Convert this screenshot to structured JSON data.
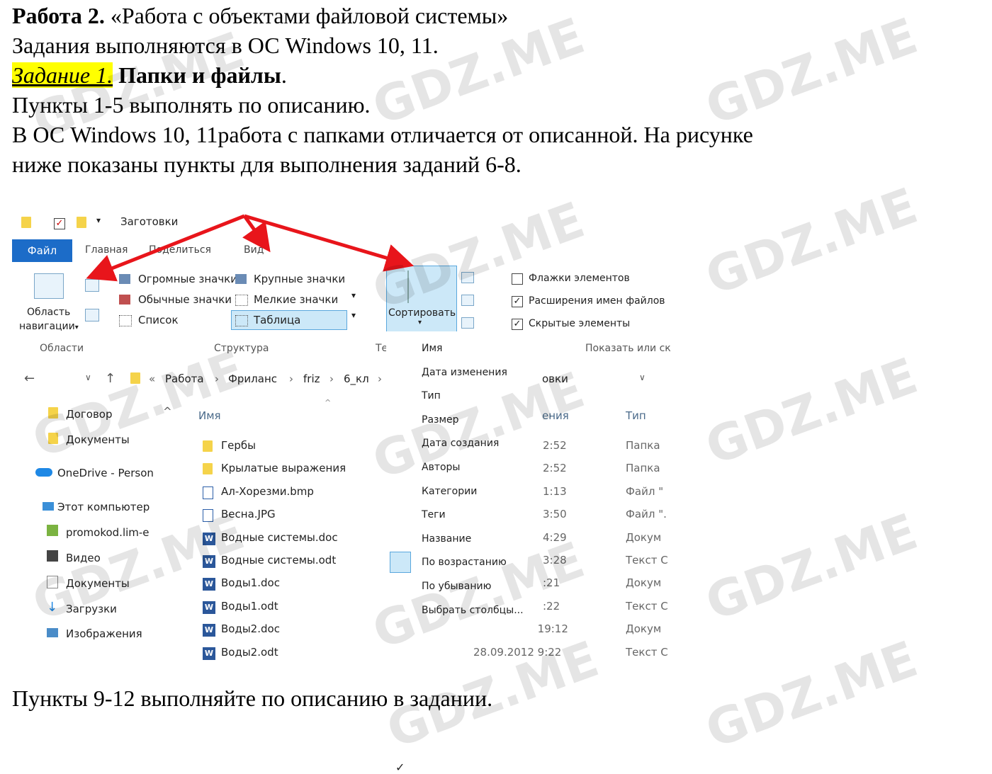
{
  "doc": {
    "title_bold": "Работа 2.",
    "title_rest": " «Работа с объектами файловой системы»",
    "os_line": "Задания выполняются в ОС Windows 10, 11.",
    "task_label": "Задание 1.",
    "task_title": " Папки и файлы",
    "task_dot": ".",
    "items_1_5": "Пункты 1-5 выполнять по описанию.",
    "note_line1": "В ОС Windows 10, 11работа с папками отличается от описанной. На рисунке",
    "note_line2": "ниже показаны пункты для выполнения заданий 6-8.",
    "items_9_12": "Пункты 9-12 выполняйте по описанию в задании."
  },
  "explorer": {
    "window_title": "Заготовки",
    "tabs": {
      "file": "Файл",
      "home": "Главная",
      "share": "Поделиться",
      "view": "Вид"
    },
    "ribbon": {
      "nav_pane": "Область",
      "nav_pane2": "навигации",
      "nav_pane_arrow": "▾",
      "layout": [
        "Огромные значки",
        "Крупные значки",
        "Обычные значки",
        "Мелкие значки",
        "Список",
        "Таблица"
      ],
      "sort": "Сортировать",
      "checkboxes": [
        "Флажки элементов",
        "Расширения имен файлов",
        "Скрытые элементы"
      ],
      "checked": [
        false,
        true,
        true
      ],
      "groups": {
        "panes": "Области",
        "structure": "Структура",
        "current": "Те",
        "show": "Показать или ск"
      }
    },
    "address": [
      "Работа",
      "Фриланс",
      "friz",
      "6_кл"
    ],
    "address_tail": "овки",
    "sort_menu": [
      "Имя",
      "Дата изменения",
      "Тип",
      "Размер",
      "Дата создания",
      "Авторы",
      "Категории",
      "Теги",
      "Название",
      "По возрастанию",
      "По убыванию",
      "Выбрать столбцы..."
    ],
    "nav_items": [
      "Договор",
      "Документы",
      "OneDrive - Person",
      "Этот компьютер",
      "promokod.lim-e",
      "Видео",
      "Документы",
      "Загрузки",
      "Изображения"
    ],
    "columns": {
      "name": "Имя",
      "date": "ения",
      "type": "Тип"
    },
    "files": [
      {
        "name": "Гербы",
        "date": "2:52",
        "type": "Папка"
      },
      {
        "name": "Крылатые выражения",
        "date": "2:52",
        "type": "Папка"
      },
      {
        "name": "Ал-Хорезми.bmp",
        "date": "1:13",
        "type": "Файл \""
      },
      {
        "name": "Весна.JPG",
        "date": "3:50",
        "type": "Файл \"."
      },
      {
        "name": "Водные системы.doc",
        "date": "4:29",
        "type": "Докум"
      },
      {
        "name": "Водные системы.odt",
        "date": "3:28",
        "type": "Текст С"
      },
      {
        "name": "Воды1.doc",
        "date": ":21",
        "type": "Докум"
      },
      {
        "name": "Воды1.odt",
        "date": ":22",
        "type": "Текст С"
      },
      {
        "name": "Воды2.doc",
        "date": "27.07.2002 19:12",
        "type": "Докум"
      },
      {
        "name": "Воды2.odt",
        "date": "28.09.2012 9:22",
        "type": "Текст С"
      }
    ]
  },
  "watermark": "GDZ.ME",
  "colors": {
    "ribbon_blue": "#1c6cc8",
    "arrow_red": "#e8151b",
    "highlight": "#ffff00"
  }
}
